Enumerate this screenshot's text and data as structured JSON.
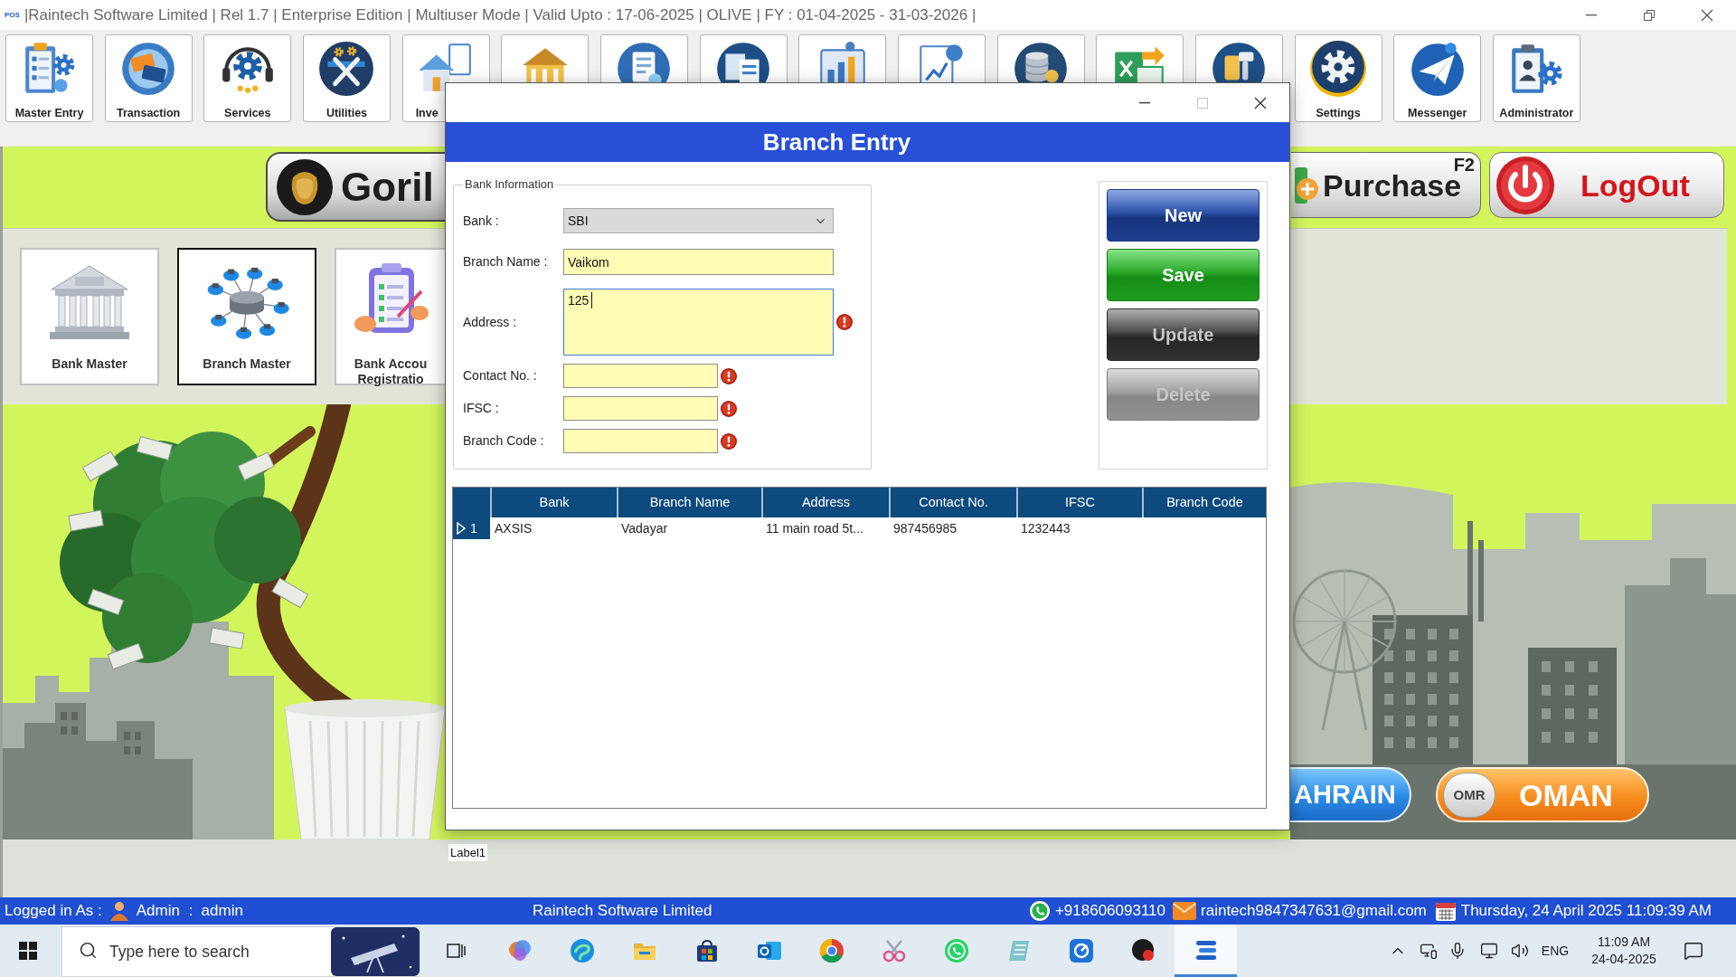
{
  "window": {
    "app_icon": "POS",
    "title": "|Raintech Software Limited | Rel 1.7 | Enterprise Edition | Multiuser Mode | Valid Upto : 17-06-2025 | OLIVE | FY : 01-04-2025 - 31-03-2026 |"
  },
  "toolbar": [
    {
      "kind": "module",
      "label": "Master Entry"
    },
    {
      "kind": "module",
      "label": "Transaction"
    },
    {
      "kind": "module",
      "label": "Services"
    },
    {
      "kind": "module",
      "label": "Utilities"
    },
    {
      "kind": "module",
      "label": "Inve"
    },
    {
      "kind": "covered"
    },
    {
      "kind": "covered"
    },
    {
      "kind": "covered"
    },
    {
      "kind": "covered"
    },
    {
      "kind": "covered"
    },
    {
      "kind": "covered"
    },
    {
      "kind": "covered"
    },
    {
      "kind": "covered"
    },
    {
      "kind": "module",
      "label": "Settings"
    },
    {
      "kind": "module",
      "label": "Messenger"
    },
    {
      "kind": "module",
      "label": "Administrator"
    }
  ],
  "quick_bar": {
    "brand": "Goril",
    "purchase": {
      "label": "Purchase",
      "shortcut": "F2"
    },
    "logout": "LogOut"
  },
  "tiles": [
    {
      "label": "Bank Master",
      "selected": false
    },
    {
      "label": "Branch Master",
      "selected": true
    },
    {
      "label": "Bank Accou Registratio",
      "selected": false
    }
  ],
  "dialog": {
    "window_controls": [
      {
        "kind": "minimize",
        "disabled": false
      },
      {
        "kind": "maximize",
        "disabled": true
      },
      {
        "kind": "close",
        "disabled": false
      }
    ],
    "title": "Branch Entry",
    "group": "Bank Information",
    "fields": [
      {
        "kind": "select",
        "label": "Bank :",
        "value": "SBI",
        "focused": false,
        "error": false
      },
      {
        "kind": "line",
        "label": "Branch Name :",
        "value": "Vaikom",
        "focused": false,
        "error": false
      },
      {
        "kind": "area",
        "label": "Address :",
        "value": "125",
        "focused": true,
        "error": true
      },
      {
        "kind": "short",
        "label": "Contact No. :",
        "focused": false,
        "error": true
      },
      {
        "kind": "short",
        "label": "IFSC :",
        "focused": false,
        "error": true
      },
      {
        "kind": "short",
        "label": "Branch Code :",
        "focused": false,
        "error": true
      }
    ],
    "buttons": [
      {
        "label": "New",
        "kind": "primary",
        "disabled": false
      },
      {
        "label": "Save",
        "kind": "success",
        "disabled": false
      },
      {
        "label": "Update",
        "kind": "dark",
        "disabled": true
      },
      {
        "label": "Delete",
        "kind": "muted",
        "disabled": true
      }
    ],
    "grid": {
      "columns": [
        "Bank",
        "Branch Name",
        "Address",
        "Contact No.",
        "IFSC",
        "Branch Code"
      ],
      "rows": [
        {
          "number": "1",
          "selected": true,
          "cells": [
            "AXSIS",
            "Vadayar",
            "11 main road 5t...",
            "987456985",
            "1232443"
          ]
        }
      ]
    }
  },
  "footer_label": "Label1",
  "country_buttons": [
    {
      "kind": "plain",
      "label": "AHRAIN"
    },
    {
      "kind": "coin",
      "coin": "OMR",
      "label": "OMAN"
    }
  ],
  "status_bar": {
    "user_label": "Logged in As :",
    "user": "Admin  :  admin",
    "company": "Raintech Software Limited",
    "phone": "+918606093110",
    "email": "raintech9847347631@gmail.com",
    "datetime": "Thursday, 24 April 2025 11:09:39 AM"
  },
  "taskbar": {
    "search_placeholder": "Type here to search",
    "apps": [
      {
        "selected": false
      },
      {
        "selected": false
      },
      {
        "selected": false
      },
      {
        "selected": false
      },
      {
        "selected": false
      },
      {
        "selected": false
      },
      {
        "selected": false
      },
      {
        "selected": false
      },
      {
        "selected": false
      },
      {
        "selected": false
      },
      {
        "selected": false
      },
      {
        "selected": true
      }
    ],
    "language": "ENG",
    "time": "11:09 AM",
    "date": "24-04-2025"
  }
}
